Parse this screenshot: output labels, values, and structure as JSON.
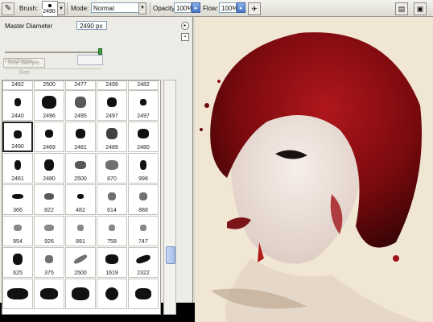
{
  "options_bar": {
    "brush_label": "Brush:",
    "brush_size": "2490",
    "mode_label": "Mode:",
    "mode_value": "Normal",
    "opacity_label": "Opacity:",
    "opacity_value": "100%",
    "flow_label": "Flow:",
    "flow_value": "100%"
  },
  "brush_panel": {
    "master_diameter_label": "Master Diameter",
    "master_diameter_value": "2490 px",
    "use_sample_size_label": "Use Sample Size",
    "hardness_label": "Hardness:",
    "top_row_sizes": [
      "2462",
      "2500",
      "2477",
      "2499",
      "2482"
    ],
    "rows": [
      [
        "2440",
        "2496",
        "2495",
        "2497",
        "2497"
      ],
      [
        "2490",
        "2469",
        "2481",
        "2489",
        "2480"
      ],
      [
        "2461",
        "2480",
        "2500",
        "870",
        "998"
      ],
      [
        "366",
        "822",
        "482",
        "614",
        "888"
      ],
      [
        "954",
        "926",
        "891",
        "758",
        "747"
      ],
      [
        "625",
        "375",
        "2500",
        "1619",
        "2322"
      ]
    ],
    "selected_brush": "2490"
  },
  "colors": {
    "accent_blue": "#4a78c8",
    "slider_green": "#3fa03f",
    "hair_red": "#8a0f12"
  }
}
